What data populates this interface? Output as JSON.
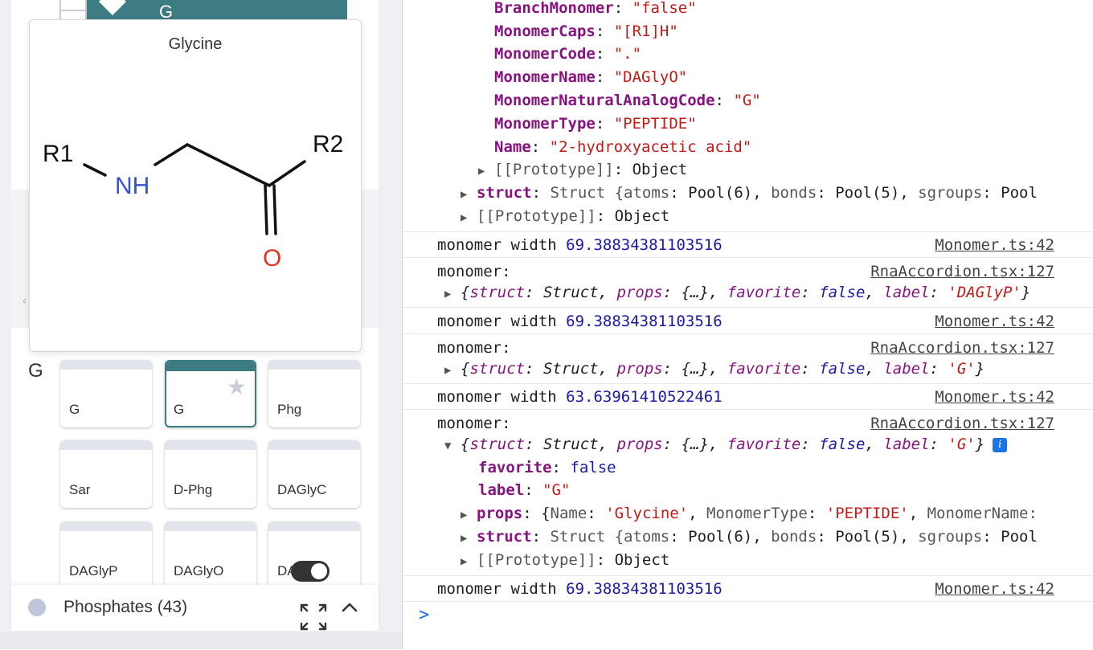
{
  "left": {
    "top_selected_label": "G",
    "preview": {
      "title": "Glycine",
      "atoms": {
        "r1": "R1",
        "nh": "NH",
        "r2": "R2",
        "o": "O"
      }
    },
    "group_letter": "G",
    "cards": [
      {
        "label": "G",
        "selected": false
      },
      {
        "label": "G",
        "selected": true
      },
      {
        "label": "Phg",
        "selected": false
      },
      {
        "label": "Sar",
        "selected": false
      },
      {
        "label": "D-Phg",
        "selected": false
      },
      {
        "label": "DAGlyC",
        "selected": false
      },
      {
        "label": "DAGlyP",
        "selected": false
      },
      {
        "label": "DAGlyO",
        "selected": false
      },
      {
        "label": "DA",
        "selected": false
      }
    ],
    "phosphates_label": "Phosphates (43)",
    "accent_color": "#3e7c84"
  },
  "console": {
    "obj1": {
      "branch_key": "BranchMonomer",
      "branch_val": "\"false\"",
      "caps_key": "MonomerCaps",
      "caps_val": "\"[R1]H\"",
      "code_key": "MonomerCode",
      "code_val": "\".\"",
      "name_key": "MonomerName",
      "name_val": "\"DAGlyO\"",
      "nat_key": "MonomerNaturalAnalogCode",
      "nat_val": "\"G\"",
      "type_key": "MonomerType",
      "type_val": "\"PEPTIDE\"",
      "name2_key": "Name",
      "name2_val": "\"2-hydroxyacetic acid\"",
      "proto_inner": "[[Prototype]]",
      "proto_inner_val": "Object",
      "struct_key": "struct",
      "struct_head": "Struct {",
      "atoms_key": "atoms",
      "atoms_val": "Pool(6)",
      "bonds_key": "bonds",
      "bonds_val": "Pool(5)",
      "sgroups_key": "sgroups",
      "sgroups_val": "Pool",
      "proto_outer": "[[Prototype]]",
      "proto_outer_val": "Object"
    },
    "logs": [
      {
        "text": "monomer width",
        "num": "69.38834381103516",
        "src": "Monomer.ts:42"
      },
      {
        "text": "monomer:",
        "src": "RnaAccordion.tsx:127",
        "label_val": "'DAGlyP'"
      },
      {
        "text": "monomer width",
        "num": "69.38834381103516",
        "src": "Monomer.ts:42"
      },
      {
        "text": "monomer:",
        "src": "RnaAccordion.tsx:127",
        "label_val": "'G'"
      },
      {
        "text": "monomer width",
        "num": "63.63961410522461",
        "src": "Monomer.ts:42"
      },
      {
        "text": "monomer:",
        "src": "RnaAccordion.tsx:127",
        "label_val": "'G'"
      },
      {
        "text": "monomer width",
        "num": "69.38834381103516",
        "src": "Monomer.ts:42"
      }
    ],
    "summary": {
      "struct_key": "struct",
      "struct_val": "Struct",
      "props_key": "props",
      "props_val": "{…}",
      "fav_key": "favorite",
      "fav_val": "false",
      "label_key": "label"
    },
    "expanded": {
      "favorite_key": "favorite",
      "favorite_val": "false",
      "label_key": "label",
      "label_val": "\"G\"",
      "props_key": "props",
      "props_name_key": "Name",
      "props_name_val": "'Glycine'",
      "props_type_key": "MonomerType",
      "props_type_val": "'PEPTIDE'",
      "props_mname_key": "MonomerName:",
      "struct_key": "struct",
      "struct_head": "Struct {",
      "atoms_key": "atoms",
      "atoms_val": "Pool(6)",
      "bonds_key": "bonds",
      "bonds_val": "Pool(5)",
      "sgroups_key": "sgroups",
      "sgroups_val": "Pool",
      "proto": "[[Prototype]]",
      "proto_val": "Object",
      "info_icon": "i"
    },
    "prompt": ">"
  }
}
